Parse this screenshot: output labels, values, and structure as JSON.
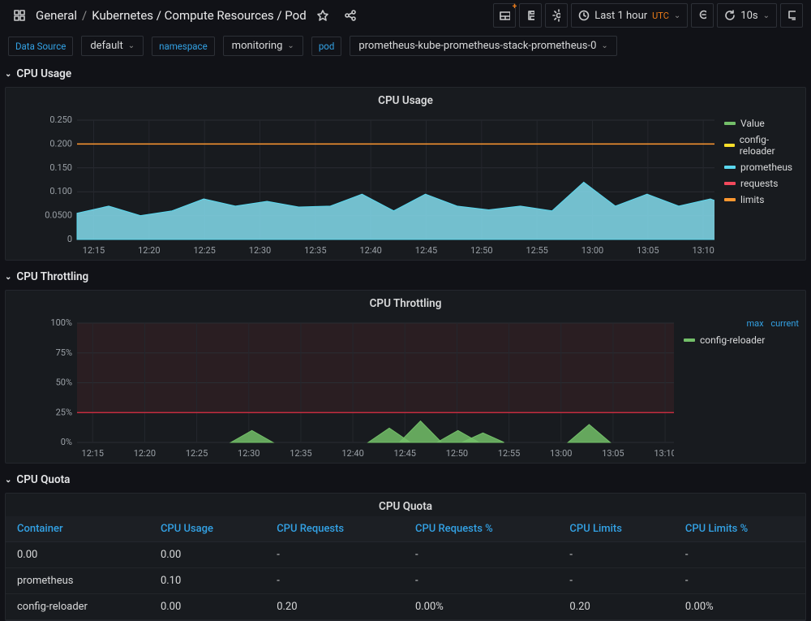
{
  "header": {
    "breadcrumb": [
      "General",
      "Kubernetes / Compute Resources / Pod"
    ],
    "timerange": "Last 1 hour",
    "tz": "UTC",
    "refresh": "10s"
  },
  "vars": {
    "datasource_label": "Data Source",
    "datasource_value": "default",
    "namespace_label": "namespace",
    "namespace_value": "monitoring",
    "pod_label": "pod",
    "pod_value": "prometheus-kube-prometheus-stack-prometheus-0"
  },
  "rows": {
    "r1": "CPU Usage",
    "r2": "CPU Throttling",
    "r3": "CPU Quota"
  },
  "panels": {
    "cpu_usage_title": "CPU Usage",
    "cpu_throttling_title": "CPU Throttling",
    "cpu_quota_title": "CPU Quota"
  },
  "legend1": {
    "s1": "Value",
    "s2": "config-reloader",
    "s3": "prometheus",
    "s4": "requests",
    "s5": "limits"
  },
  "legend2": {
    "max": "max",
    "current": "current",
    "s1": "config-reloader"
  },
  "table": {
    "h1": "Container",
    "h2": "CPU Usage",
    "h3": "CPU Requests",
    "h4": "CPU Requests %",
    "h5": "CPU Limits",
    "h6": "CPU Limits %",
    "rows": [
      {
        "c1": "0.00",
        "c2": "0.00",
        "c3": "-",
        "c4": "-",
        "c5": "-",
        "c6": "-"
      },
      {
        "c1": "prometheus",
        "c2": "0.10",
        "c3": "-",
        "c4": "-",
        "c5": "-",
        "c6": "-"
      },
      {
        "c1": "config-reloader",
        "c2": "0.00",
        "c3": "0.20",
        "c4": "0.00%",
        "c5": "0.20",
        "c6": "0.00%"
      }
    ]
  },
  "axes": {
    "x_times": [
      "12:15",
      "12:20",
      "12:25",
      "12:30",
      "12:35",
      "12:40",
      "12:45",
      "12:50",
      "12:55",
      "13:00",
      "13:05",
      "13:10"
    ],
    "y1": [
      "0",
      "0.0500",
      "0.100",
      "0.150",
      "0.200",
      "0.250"
    ],
    "y2": [
      "0%",
      "25%",
      "50%",
      "75%",
      "100%"
    ]
  },
  "chart_data": [
    {
      "type": "area",
      "title": "CPU Usage",
      "xlabel": "",
      "ylabel": "",
      "ylim": [
        0,
        0.25
      ],
      "x": [
        "12:15",
        "12:20",
        "12:25",
        "12:30",
        "12:35",
        "12:40",
        "12:45",
        "12:50",
        "12:55",
        "13:00",
        "13:05",
        "13:10"
      ],
      "series": [
        {
          "name": "Value",
          "color": "#73bf69",
          "values": [
            0,
            0,
            0,
            0,
            0,
            0,
            0,
            0,
            0,
            0,
            0,
            0
          ]
        },
        {
          "name": "config-reloader",
          "color": "#fade2a",
          "values": [
            0,
            0,
            0,
            0,
            0,
            0,
            0,
            0,
            0,
            0,
            0,
            0
          ]
        },
        {
          "name": "prometheus",
          "color": "#5bd8ef",
          "values": [
            0.055,
            0.065,
            0.06,
            0.085,
            0.075,
            0.08,
            0.095,
            0.065,
            0.095,
            0.07,
            0.065,
            0.12,
            0.075,
            0.09,
            0.075,
            0.085
          ]
        },
        {
          "name": "requests",
          "color": "#f2495c",
          "values": [
            0.2,
            0.2,
            0.2,
            0.2,
            0.2,
            0.2,
            0.2,
            0.2,
            0.2,
            0.2,
            0.2,
            0.2
          ]
        },
        {
          "name": "limits",
          "color": "#ff9830",
          "values": [
            0.2,
            0.2,
            0.2,
            0.2,
            0.2,
            0.2,
            0.2,
            0.2,
            0.2,
            0.2,
            0.2,
            0.2
          ]
        }
      ]
    },
    {
      "type": "area",
      "title": "CPU Throttling",
      "xlabel": "",
      "ylabel": "",
      "ylim": [
        0,
        100
      ],
      "x": [
        "12:15",
        "12:20",
        "12:25",
        "12:30",
        "12:35",
        "12:40",
        "12:45",
        "12:50",
        "12:55",
        "13:00",
        "13:05",
        "13:10"
      ],
      "threshold": 25,
      "series": [
        {
          "name": "config-reloader",
          "color": "#73bf69",
          "values": [
            0,
            0,
            0,
            0,
            10,
            0,
            0,
            12,
            18,
            10,
            8,
            0,
            0,
            0,
            15,
            0
          ]
        }
      ]
    },
    {
      "type": "table",
      "title": "CPU Quota",
      "columns": [
        "Container",
        "CPU Usage",
        "CPU Requests",
        "CPU Requests %",
        "CPU Limits",
        "CPU Limits %"
      ],
      "rows": [
        [
          "0.00",
          "0.00",
          "-",
          "-",
          "-",
          "-"
        ],
        [
          "prometheus",
          "0.10",
          "-",
          "-",
          "-",
          "-"
        ],
        [
          "config-reloader",
          "0.00",
          "0.20",
          "0.00%",
          "0.20",
          "0.00%"
        ]
      ]
    }
  ]
}
